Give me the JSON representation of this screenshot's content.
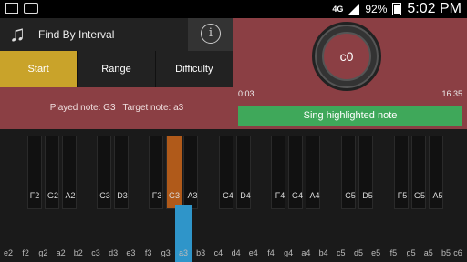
{
  "status": {
    "network": "4G",
    "battery": "92%",
    "time": "5:02 PM"
  },
  "header": {
    "app_title": "Find By Interval",
    "info_icon": "i"
  },
  "tabs": [
    {
      "label": "Start",
      "active": true
    },
    {
      "label": "Range",
      "active": false
    },
    {
      "label": "Difficulty",
      "active": false
    }
  ],
  "info": {
    "played_text": "Played note: G3 | Target note: a3"
  },
  "dial": {
    "note": "c0",
    "time_start": "0:03",
    "time_end": "16.35"
  },
  "sing_button": "Sing highlighted note",
  "black_labels": [
    "F2",
    "G2",
    "A2",
    "C3",
    "D3",
    "F3",
    "G3",
    "A3",
    "C4",
    "D4",
    "F4",
    "G4",
    "A4",
    "C5",
    "D5",
    "F5",
    "G5",
    "A5"
  ],
  "white_labels": [
    "e2",
    "f2",
    "g2",
    "a2",
    "b2",
    "c3",
    "d3",
    "e3",
    "f3",
    "g3",
    "a3",
    "b3",
    "c4",
    "d4",
    "e4",
    "f4",
    "g4",
    "a4",
    "b4",
    "c5",
    "d5",
    "e5",
    "f5",
    "g5",
    "a5",
    "b5",
    "c6"
  ],
  "highlights": {
    "played": "G3",
    "target": "a3"
  },
  "colors": {
    "accent": "#c9a32a",
    "panel": "#8b3f44",
    "go": "#3fa85a",
    "played": "#b05a1a",
    "target": "#2f95c9"
  }
}
